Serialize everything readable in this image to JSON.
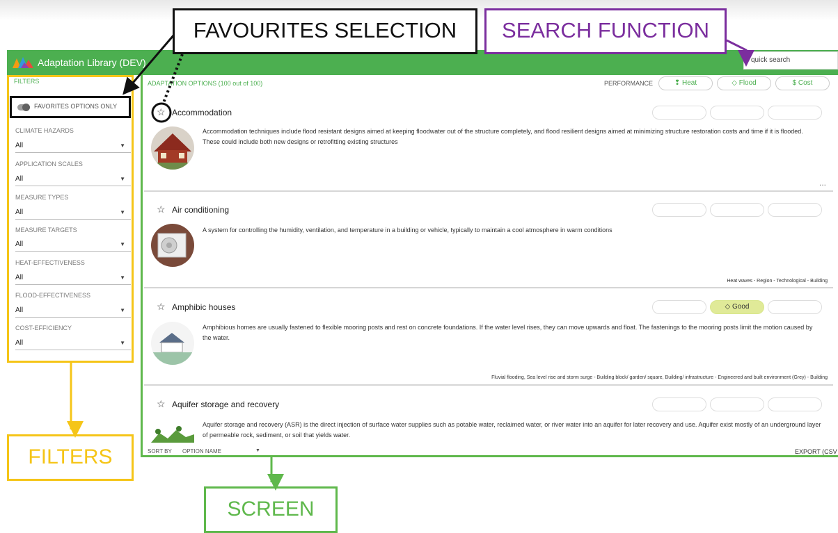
{
  "app": {
    "title": "Adaptation Library (DEV)"
  },
  "search": {
    "placeholder": "quick search"
  },
  "sidebar": {
    "title": "FILTERS",
    "favorites_label": "FAVORITES OPTIONS ONLY",
    "filters": [
      {
        "label": "CLIMATE HAZARDS",
        "value": "All"
      },
      {
        "label": "APPLICATION SCALES",
        "value": "All"
      },
      {
        "label": "MEASURE TYPES",
        "value": "All"
      },
      {
        "label": "MEASURE TARGETS",
        "value": "All"
      },
      {
        "label": "HEAT-EFFECTIVENESS",
        "value": "All"
      },
      {
        "label": "FLOOD-EFFECTIVENESS",
        "value": "All"
      },
      {
        "label": "COST-EFFICIENCY",
        "value": "All"
      }
    ]
  },
  "main": {
    "options_count": "ADAPTATION OPTIONS (100 out of 100)",
    "performance_label": "PERFORMANCE",
    "performance_buttons": [
      {
        "label": "❢ Heat"
      },
      {
        "label": "◇ Flood"
      },
      {
        "label": "$ Cost"
      }
    ],
    "options": [
      {
        "title": "Accommodation",
        "description": "Accommodation techniques include flood resistant designs aimed at keeping floodwater out of the structure completely, and flood resilient designs aimed at minimizing structure restoration costs and time if it is flooded. These could include both new designs or retrofitting existing structures",
        "tags": "",
        "flood_rating": ""
      },
      {
        "title": "Air conditioning",
        "description": "A system for controlling the humidity, ventilation, and temperature in a building or vehicle, typically to maintain a cool atmosphere in warm conditions",
        "tags": "Heat waves - Region - Technological - Building",
        "flood_rating": ""
      },
      {
        "title": "Amphibic houses",
        "description": "Amphibious homes are usually fastened to flexible mooring posts and rest on concrete foundations. If the water level rises, they can move upwards and float. The fastenings to the mooring posts limit the motion caused by the water.",
        "tags": "Fluvial flooding, Sea level rise and storm surge - Building block/ garden/ square, Building/ infrastructure - Engineered and built environment (Grey) - Building",
        "flood_rating": "◇ Good"
      },
      {
        "title": "Aquifer storage and recovery",
        "description": "Aquifer storage and recovery (ASR) is the direct injection of surface water supplies such as potable water, reclaimed water, or river water into an aquifer for later recovery and use. Aquifer exist mostly of an underground layer of permeable rock, sediment, or soil that yields water.",
        "tags": "",
        "flood_rating": ""
      }
    ],
    "more": "...",
    "footer": {
      "sort_by": "SORT BY",
      "sort_value": "OPTION NAME",
      "export": "EXPORT (CSV"
    }
  },
  "annotations": {
    "favourites": "FAVOURITES SELECTION",
    "search": "SEARCH FUNCTION",
    "filters": "FILTERS",
    "screen": "SCREEN"
  },
  "colors": {
    "app_green": "#4caf50",
    "filters_yellow": "#f5c518",
    "search_purple": "#7b2e9e",
    "screen_green": "#5fb84c",
    "good_rating": "#e0ea98"
  },
  "icons": [
    "library-logo-icon",
    "star-icon",
    "caret-down-icon",
    "toggle-icon"
  ]
}
